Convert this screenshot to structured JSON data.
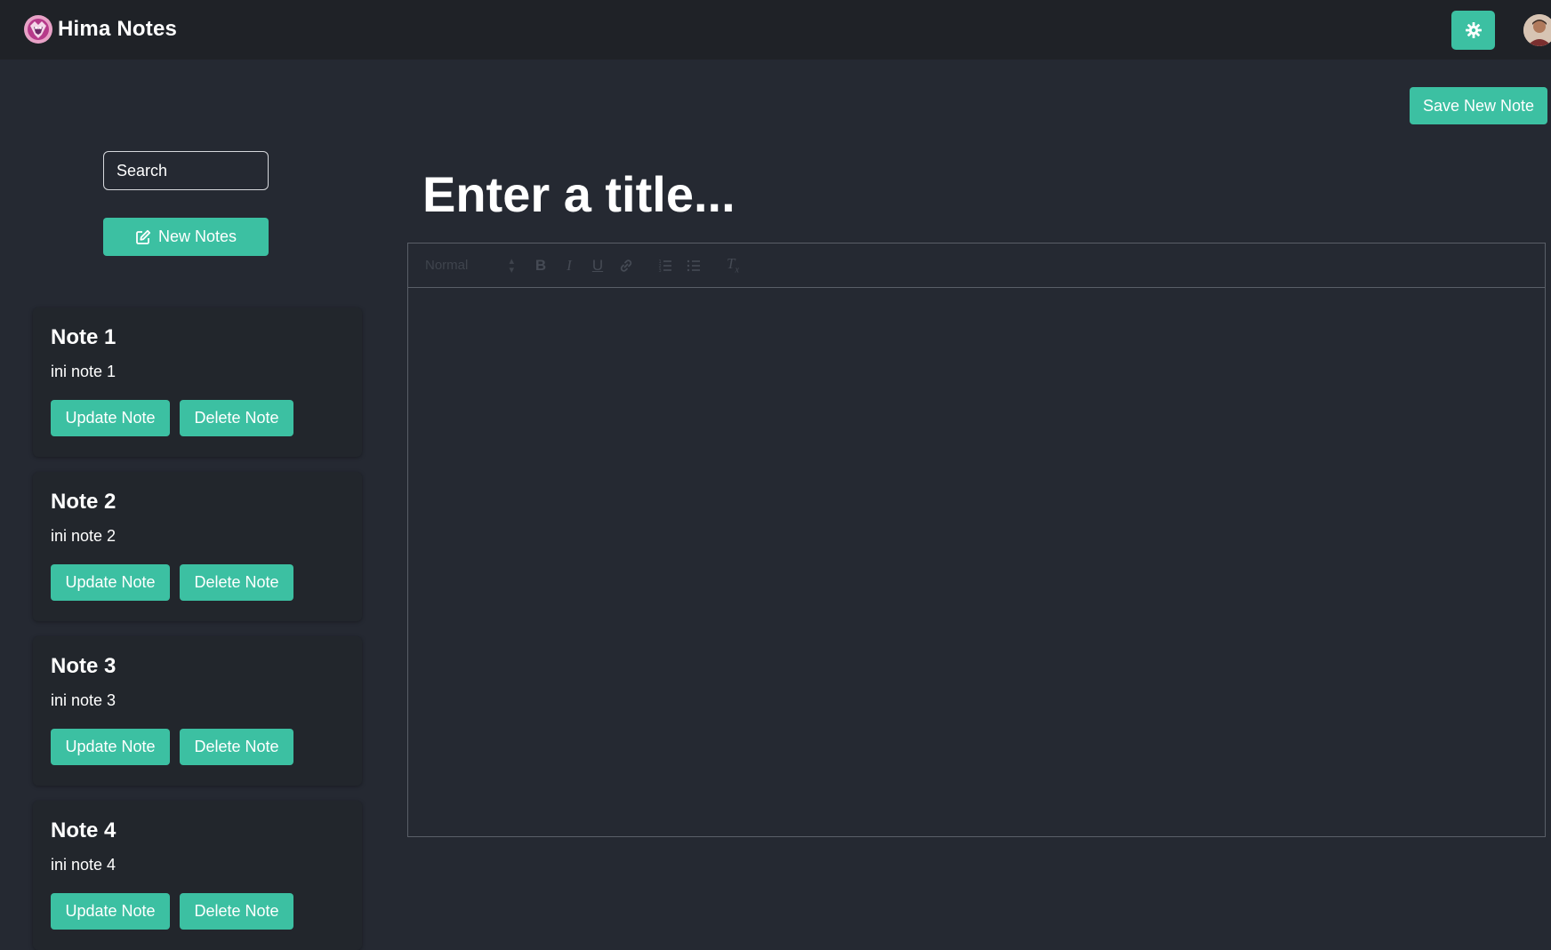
{
  "navbar": {
    "brand": "Hima Notes",
    "theme_toggle_icon": "gear-icon",
    "avatar_icon": "avatar"
  },
  "colors": {
    "accent": "#3cc0a2",
    "background": "#252932",
    "navbar": "#1f2227",
    "card": "#22262c"
  },
  "editor_actions": {
    "save_label": "Save New Note"
  },
  "sidebar": {
    "search_placeholder": "Search",
    "new_notes_label": "New Notes",
    "notes": [
      {
        "title": "Note 1",
        "body": "ini note 1",
        "update_label": "Update Note",
        "delete_label": "Delete Note"
      },
      {
        "title": "Note 2",
        "body": "ini note 2",
        "update_label": "Update Note",
        "delete_label": "Delete Note"
      },
      {
        "title": "Note 3",
        "body": "ini note 3",
        "update_label": "Update Note",
        "delete_label": "Delete Note"
      },
      {
        "title": "Note 4",
        "body": "ini note 4",
        "update_label": "Update Note",
        "delete_label": "Delete Note"
      }
    ]
  },
  "editor": {
    "title_placeholder": "Enter a title...",
    "toolbar": {
      "header_select": "Normal",
      "buttons": [
        "bold-icon",
        "italic-icon",
        "underline-icon",
        "link-icon",
        "ordered-list-icon",
        "bullet-list-icon",
        "clear-format-icon"
      ]
    }
  }
}
